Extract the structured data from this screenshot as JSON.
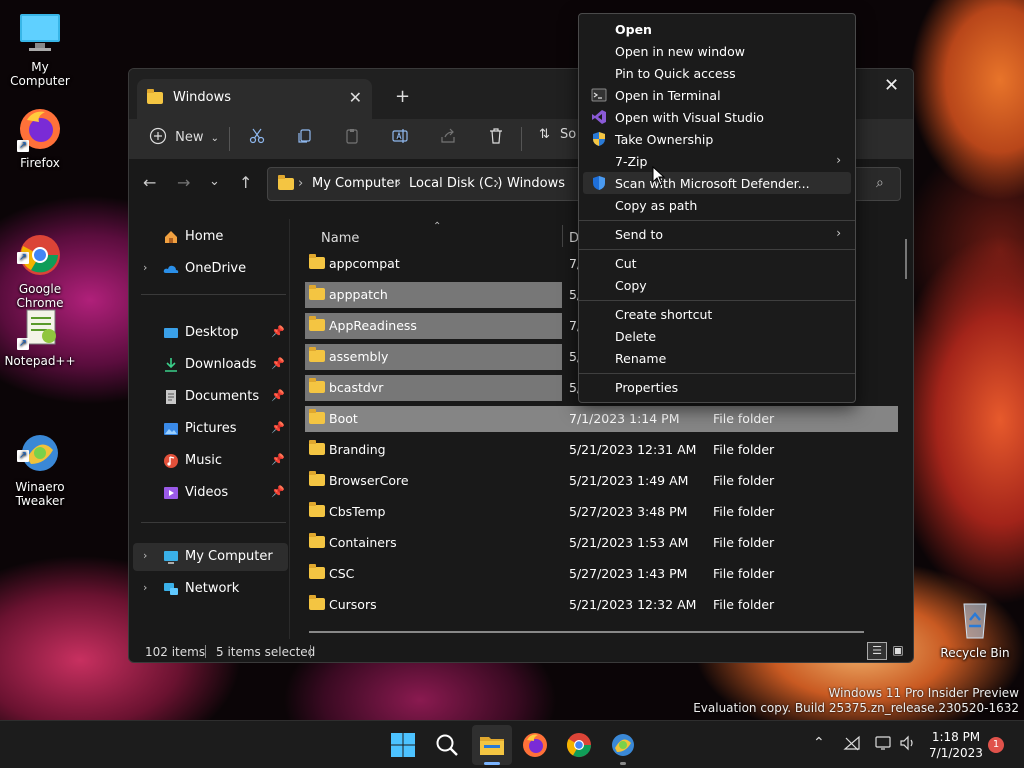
{
  "desktop": {
    "icons": [
      {
        "label": "My Computer"
      },
      {
        "label": "Firefox"
      },
      {
        "label": "Google\nChrome"
      },
      {
        "label": "Notepad++"
      },
      {
        "label": "Winaero\nTweaker"
      },
      {
        "label": "Recycle Bin"
      }
    ],
    "watermark_line1": "Windows 11 Pro Insider Preview",
    "watermark_line2": "Evaluation copy. Build 25375.zn_release.230520-1632"
  },
  "explorer": {
    "tab_title": "Windows",
    "tab_close": "✕",
    "new_tab": "+",
    "window_close": "✕",
    "toolbar": {
      "new_label": "New",
      "sort_label": "So"
    },
    "breadcrumb": [
      "My Computer",
      "Local Disk (C:)",
      "Windows"
    ],
    "sidebar": {
      "items": [
        {
          "label": "Home",
          "icon": "home-icon"
        },
        {
          "label": "OneDrive",
          "icon": "cloud-icon"
        },
        {
          "label": "Desktop",
          "icon": "desktop-icon"
        },
        {
          "label": "Downloads",
          "icon": "download-icon"
        },
        {
          "label": "Documents",
          "icon": "document-icon"
        },
        {
          "label": "Pictures",
          "icon": "picture-icon"
        },
        {
          "label": "Music",
          "icon": "music-icon"
        },
        {
          "label": "Videos",
          "icon": "video-icon"
        },
        {
          "label": "My Computer",
          "icon": "computer-icon"
        },
        {
          "label": "Network",
          "icon": "network-icon"
        }
      ]
    },
    "columns": {
      "name": "Name",
      "date": "Da"
    },
    "files": [
      {
        "name": "appcompat",
        "date": "7/",
        "type": "",
        "selected": false
      },
      {
        "name": "apppatch",
        "date": "5/",
        "type": "",
        "selected": true
      },
      {
        "name": "AppReadiness",
        "date": "7/",
        "type": "",
        "selected": true
      },
      {
        "name": "assembly",
        "date": "5/",
        "type": "",
        "selected": true
      },
      {
        "name": "bcastdvr",
        "date": "5/",
        "type": "",
        "selected": true
      },
      {
        "name": "Boot",
        "date": "7/1/2023 1:14 PM",
        "type": "File folder",
        "selected": true
      },
      {
        "name": "Branding",
        "date": "5/21/2023 12:31 AM",
        "type": "File folder",
        "selected": false
      },
      {
        "name": "BrowserCore",
        "date": "5/21/2023 1:49 AM",
        "type": "File folder",
        "selected": false
      },
      {
        "name": "CbsTemp",
        "date": "5/27/2023 3:48 PM",
        "type": "File folder",
        "selected": false
      },
      {
        "name": "Containers",
        "date": "5/21/2023 1:53 AM",
        "type": "File folder",
        "selected": false
      },
      {
        "name": "CSC",
        "date": "5/27/2023 1:43 PM",
        "type": "File folder",
        "selected": false
      },
      {
        "name": "Cursors",
        "date": "5/21/2023 12:32 AM",
        "type": "File folder",
        "selected": false
      }
    ],
    "status": {
      "count": "102 items",
      "selected": "5 items selected"
    }
  },
  "context_menu": {
    "items": [
      {
        "label": "Open"
      },
      {
        "label": "Open in new window"
      },
      {
        "label": "Pin to Quick access"
      },
      {
        "label": "Open in Terminal"
      },
      {
        "label": "Open with Visual Studio"
      },
      {
        "label": "Take Ownership"
      },
      {
        "label": "7-Zip"
      },
      {
        "label": "Scan with Microsoft Defender..."
      },
      {
        "label": "Copy as path"
      },
      {
        "label": "Send to"
      },
      {
        "label": "Cut"
      },
      {
        "label": "Copy"
      },
      {
        "label": "Create shortcut"
      },
      {
        "label": "Delete"
      },
      {
        "label": "Rename"
      },
      {
        "label": "Properties"
      }
    ]
  },
  "taskbar": {
    "time": "1:18 PM",
    "date": "7/1/2023",
    "notification_count": "1"
  }
}
